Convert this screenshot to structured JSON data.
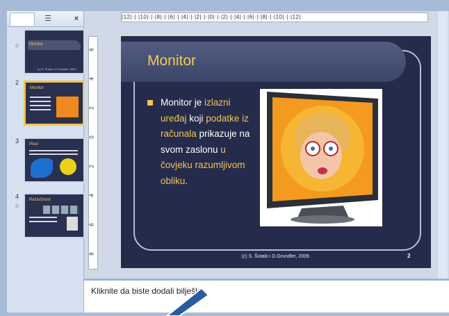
{
  "left_panel": {
    "tabs": {
      "slides_label": "",
      "outline_icon": "outline-icon",
      "close_label": "×"
    },
    "thumbnails": [
      {
        "number": "",
        "title": "Monitor",
        "caption": "(c) S. Šutalo i D.Grundler, 2009."
      },
      {
        "number": "2",
        "title": "Monitor",
        "caption": ""
      },
      {
        "number": "3",
        "title": "Pixel",
        "caption": ""
      },
      {
        "number": "4",
        "title": "Razlučivost",
        "caption": ""
      }
    ]
  },
  "ruler": {
    "horizontal": "|12|·|·|10|·|·|8|·|·|6|·|·|4|·|·|2|·|·|0|·|·|2|·|·|4|·|·|6|·|·|8|·|·|10|·|·|12|",
    "vertical": [
      "6",
      "4",
      "2",
      "0",
      "2",
      "4",
      "6",
      "8"
    ]
  },
  "slide": {
    "title": "Monitor",
    "bullet": {
      "parts": [
        {
          "text": "Monitor ",
          "highlight": false
        },
        {
          "text": "je ",
          "highlight": false
        },
        {
          "text": "izlazni uređaj ",
          "highlight": true
        },
        {
          "text": "koji ",
          "highlight": false
        },
        {
          "text": "podatke iz računala ",
          "highlight": true
        },
        {
          "text": "prikazuje na svom zaslonu ",
          "highlight": false
        },
        {
          "text": "u čovjeku razumljivom obliku",
          "highlight": true
        },
        {
          "text": ".",
          "highlight": false
        }
      ]
    },
    "footer": "(c) S. Šutalo i D.Grundler, 2009.",
    "slide_number": "2"
  },
  "notes": {
    "text": "Kliknite da biste dodali bilješke"
  },
  "colors": {
    "accent": "#f3c45c",
    "slide_bg": "#252b4a",
    "title_bar": "#4a5578"
  }
}
